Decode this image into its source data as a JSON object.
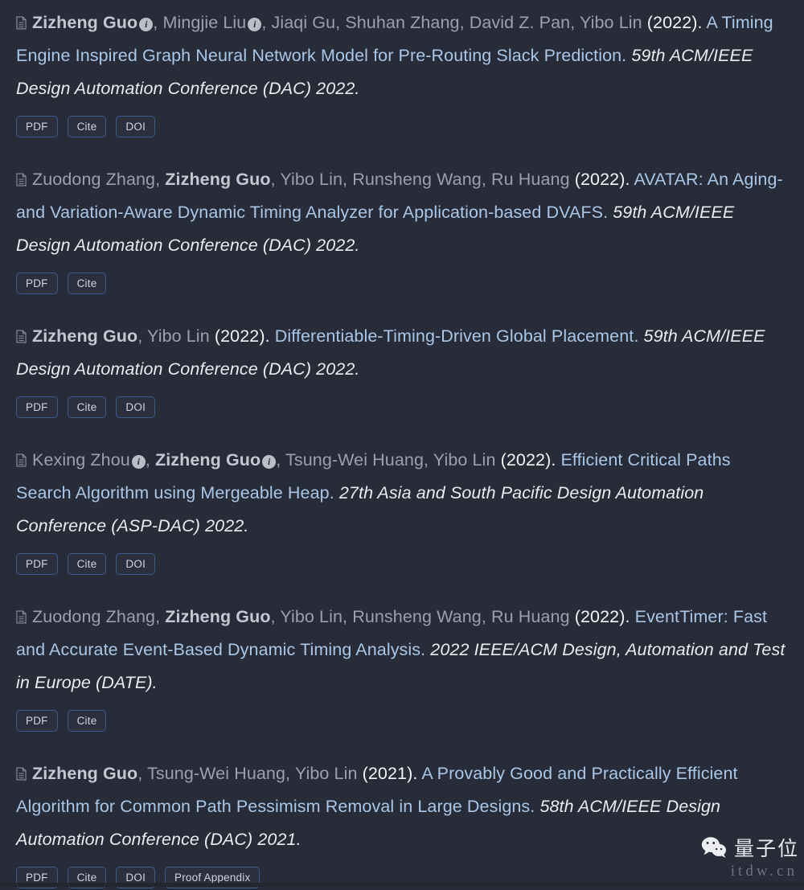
{
  "theme": {
    "background": "#282b38",
    "author_color": "#9aa1ad",
    "highlight_author_color": "#c3c9d3",
    "year_color": "#f2f4f7",
    "title_link_color": "#a9c7e8",
    "venue_color": "#e9ecf1",
    "button_border_color": "#3c5a8e",
    "button_text_color": "#cfd5de"
  },
  "icons": {
    "document": "document-icon",
    "info": "i",
    "wechat": "wechat-logo"
  },
  "publications": [
    {
      "authors": [
        {
          "name": "Zizheng Guo",
          "highlight": true,
          "info_badge": true
        },
        {
          "name": "Mingjie Liu",
          "highlight": false,
          "info_badge": true
        },
        {
          "name": "Jiaqi Gu",
          "highlight": false,
          "info_badge": false
        },
        {
          "name": "Shuhan Zhang",
          "highlight": false,
          "info_badge": false
        },
        {
          "name": "David Z. Pan",
          "highlight": false,
          "info_badge": false
        },
        {
          "name": "Yibo Lin",
          "highlight": false,
          "info_badge": false
        }
      ],
      "year": "(2022).",
      "title": "A Timing Engine Inspired Graph Neural Network Model for Pre-Routing Slack Prediction.",
      "venue": "59th ACM/IEEE Design Automation Conference (DAC) 2022.",
      "buttons": [
        "PDF",
        "Cite",
        "DOI"
      ]
    },
    {
      "authors": [
        {
          "name": "Zuodong Zhang",
          "highlight": false,
          "info_badge": false
        },
        {
          "name": "Zizheng Guo",
          "highlight": true,
          "info_badge": false
        },
        {
          "name": "Yibo Lin",
          "highlight": false,
          "info_badge": false
        },
        {
          "name": "Runsheng Wang",
          "highlight": false,
          "info_badge": false
        },
        {
          "name": "Ru Huang",
          "highlight": false,
          "info_badge": false
        }
      ],
      "year": "(2022).",
      "title": "AVATAR: An Aging- and Variation-Aware Dynamic Timing Analyzer for Application-based DVAFS.",
      "venue": "59th ACM/IEEE Design Automation Conference (DAC) 2022.",
      "buttons": [
        "PDF",
        "Cite"
      ]
    },
    {
      "authors": [
        {
          "name": "Zizheng Guo",
          "highlight": true,
          "info_badge": false
        },
        {
          "name": "Yibo Lin",
          "highlight": false,
          "info_badge": false
        }
      ],
      "year": "(2022).",
      "title": "Differentiable-Timing-Driven Global Placement.",
      "venue": "59th ACM/IEEE Design Automation Conference (DAC) 2022.",
      "buttons": [
        "PDF",
        "Cite",
        "DOI"
      ]
    },
    {
      "authors": [
        {
          "name": "Kexing Zhou",
          "highlight": false,
          "info_badge": true
        },
        {
          "name": "Zizheng Guo",
          "highlight": true,
          "info_badge": true
        },
        {
          "name": "Tsung-Wei Huang",
          "highlight": false,
          "info_badge": false
        },
        {
          "name": "Yibo Lin",
          "highlight": false,
          "info_badge": false
        }
      ],
      "year": "(2022).",
      "title": "Efficient Critical Paths Search Algorithm using Mergeable Heap.",
      "venue": "27th Asia and South Pacific Design Automation Conference (ASP-DAC) 2022.",
      "buttons": [
        "PDF",
        "Cite",
        "DOI"
      ]
    },
    {
      "authors": [
        {
          "name": "Zuodong Zhang",
          "highlight": false,
          "info_badge": false
        },
        {
          "name": "Zizheng Guo",
          "highlight": true,
          "info_badge": false
        },
        {
          "name": "Yibo Lin",
          "highlight": false,
          "info_badge": false
        },
        {
          "name": "Runsheng Wang",
          "highlight": false,
          "info_badge": false
        },
        {
          "name": "Ru Huang",
          "highlight": false,
          "info_badge": false
        }
      ],
      "year": "(2022).",
      "title": "EventTimer: Fast and Accurate Event-Based Dynamic Timing Analysis.",
      "venue": "2022 IEEE/ACM Design, Automation and Test in Europe (DATE).",
      "buttons": [
        "PDF",
        "Cite"
      ]
    },
    {
      "authors": [
        {
          "name": "Zizheng Guo",
          "highlight": true,
          "info_badge": false
        },
        {
          "name": "Tsung-Wei Huang",
          "highlight": false,
          "info_badge": false
        },
        {
          "name": "Yibo Lin",
          "highlight": false,
          "info_badge": false
        }
      ],
      "year": "(2021).",
      "title": "A Provably Good and Practically Efficient Algorithm for Common Path Pessimism Removal in Large Designs.",
      "venue": "58th ACM/IEEE Design Automation Conference (DAC) 2021.",
      "buttons": [
        "PDF",
        "Cite",
        "DOI",
        "Proof Appendix"
      ]
    }
  ],
  "watermark": {
    "brand": "量子位",
    "url": "itdw.cn"
  }
}
